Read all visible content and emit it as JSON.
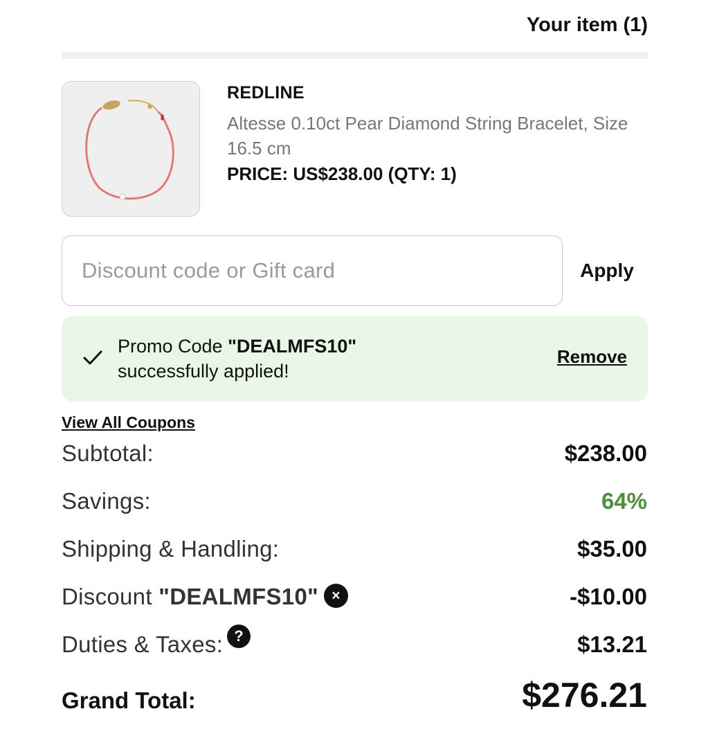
{
  "header": {
    "title": "Your item (1)"
  },
  "product": {
    "brand": "REDLINE",
    "name": "Altesse 0.10ct Pear Diamond String Bracelet, Size 16.5 cm",
    "price_line": "PRICE: US$238.00 (QTY: 1)",
    "image_icon": "bracelet-image"
  },
  "discount": {
    "placeholder": "Discount code or Gift card",
    "value": "",
    "apply_label": "Apply"
  },
  "promo": {
    "prefix": "Promo Code ",
    "code": "\"DEALMFS10\"",
    "suffix": "successfully applied!",
    "remove_label": "Remove",
    "icon": "check-icon"
  },
  "coupons_link": "View All Coupons",
  "summary": {
    "subtotal_label": "Subtotal:",
    "subtotal_value": "$238.00",
    "savings_label": "Savings:",
    "savings_value": "64%",
    "shipping_label": "Shipping & Handling:",
    "shipping_value": "$35.00",
    "discount_label": "Discount ",
    "discount_code": "\"DEALMFS10\"",
    "discount_remove_icon": "×",
    "discount_value": "-$10.00",
    "duties_label": "Duties & Taxes:",
    "duties_help_icon": "?",
    "duties_value": "$13.21",
    "grand_label": "Grand Total:",
    "grand_value": "$276.21"
  },
  "colors": {
    "promo_bg": "#e9f8e6",
    "savings": "#4e8f3a",
    "text_primary": "#111111",
    "text_muted": "#777777"
  }
}
